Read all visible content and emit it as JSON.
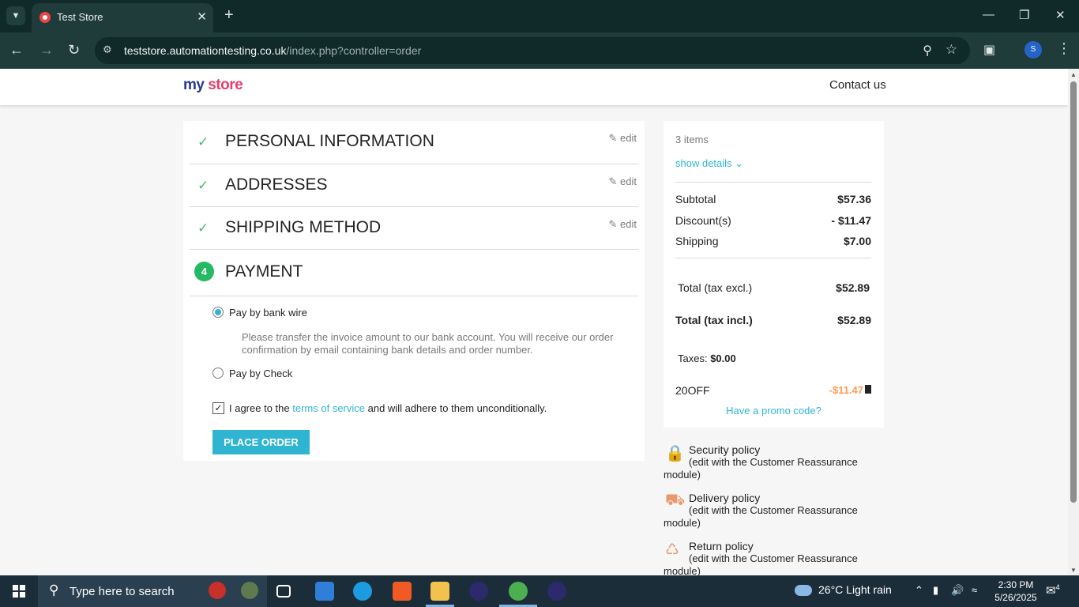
{
  "browser": {
    "tab_title": "Test Store",
    "url_host": "teststore.automationtesting.co.uk",
    "url_path": "/index.php?controller=order",
    "profile_initial": "S"
  },
  "header": {
    "logo_my": "my",
    "logo_store": "store",
    "contact": "Contact us"
  },
  "checkout": {
    "steps": [
      {
        "label": "PERSONAL INFORMATION",
        "edit": "edit"
      },
      {
        "label": "ADDRESSES",
        "edit": "edit"
      },
      {
        "label": "SHIPPING METHOD",
        "edit": "edit"
      },
      {
        "label": "PAYMENT",
        "number": "4"
      }
    ],
    "payment_options": [
      {
        "label": "Pay by bank wire",
        "selected": true
      },
      {
        "label": "Pay by Check",
        "selected": false
      }
    ],
    "bank_wire_description": "Please transfer the invoice amount to our bank account. You will receive our order confirmation by email containing bank details and order number.",
    "agree_prefix": "I agree to the",
    "agree_link": "terms of service",
    "agree_suffix": "and will adhere to them unconditionally.",
    "agree_checked": true,
    "place_order": "PLACE ORDER"
  },
  "summary": {
    "items_count": "3 items",
    "show_details": "show details",
    "subtotal_label": "Subtotal",
    "subtotal_value": "$57.36",
    "discount_label": "Discount(s)",
    "discount_value": "- $11.47",
    "shipping_label": "Shipping",
    "shipping_value": "$7.00",
    "total_excl_label": "Total (tax excl.)",
    "total_excl_value": "$52.89",
    "total_incl_label": "Total (tax incl.)",
    "total_incl_value": "$52.89",
    "taxes_label": "Taxes:",
    "taxes_value": "$0.00",
    "promo_code": "20OFF",
    "promo_amount": "-$11.47",
    "have_promo": "Have a promo code?"
  },
  "reassurance": [
    {
      "title": "Security policy",
      "desc": "(edit with the Customer Reassurance module)",
      "icon": "lock-icon"
    },
    {
      "title": "Delivery policy",
      "desc": "(edit with the Customer Reassurance module)",
      "icon": "truck-icon"
    },
    {
      "title": "Return policy",
      "desc": "(edit with the Customer Reassurance module)",
      "icon": "return-icon"
    }
  ],
  "taskbar": {
    "search_placeholder": "Type here to search",
    "weather": "26°C  Light rain",
    "time": "2:30 PM",
    "date": "5/26/2025",
    "notifications": "4"
  },
  "colors": {
    "accent": "#2fb5d2",
    "success": "#4cbb6c",
    "promo": "#ff9a52"
  }
}
